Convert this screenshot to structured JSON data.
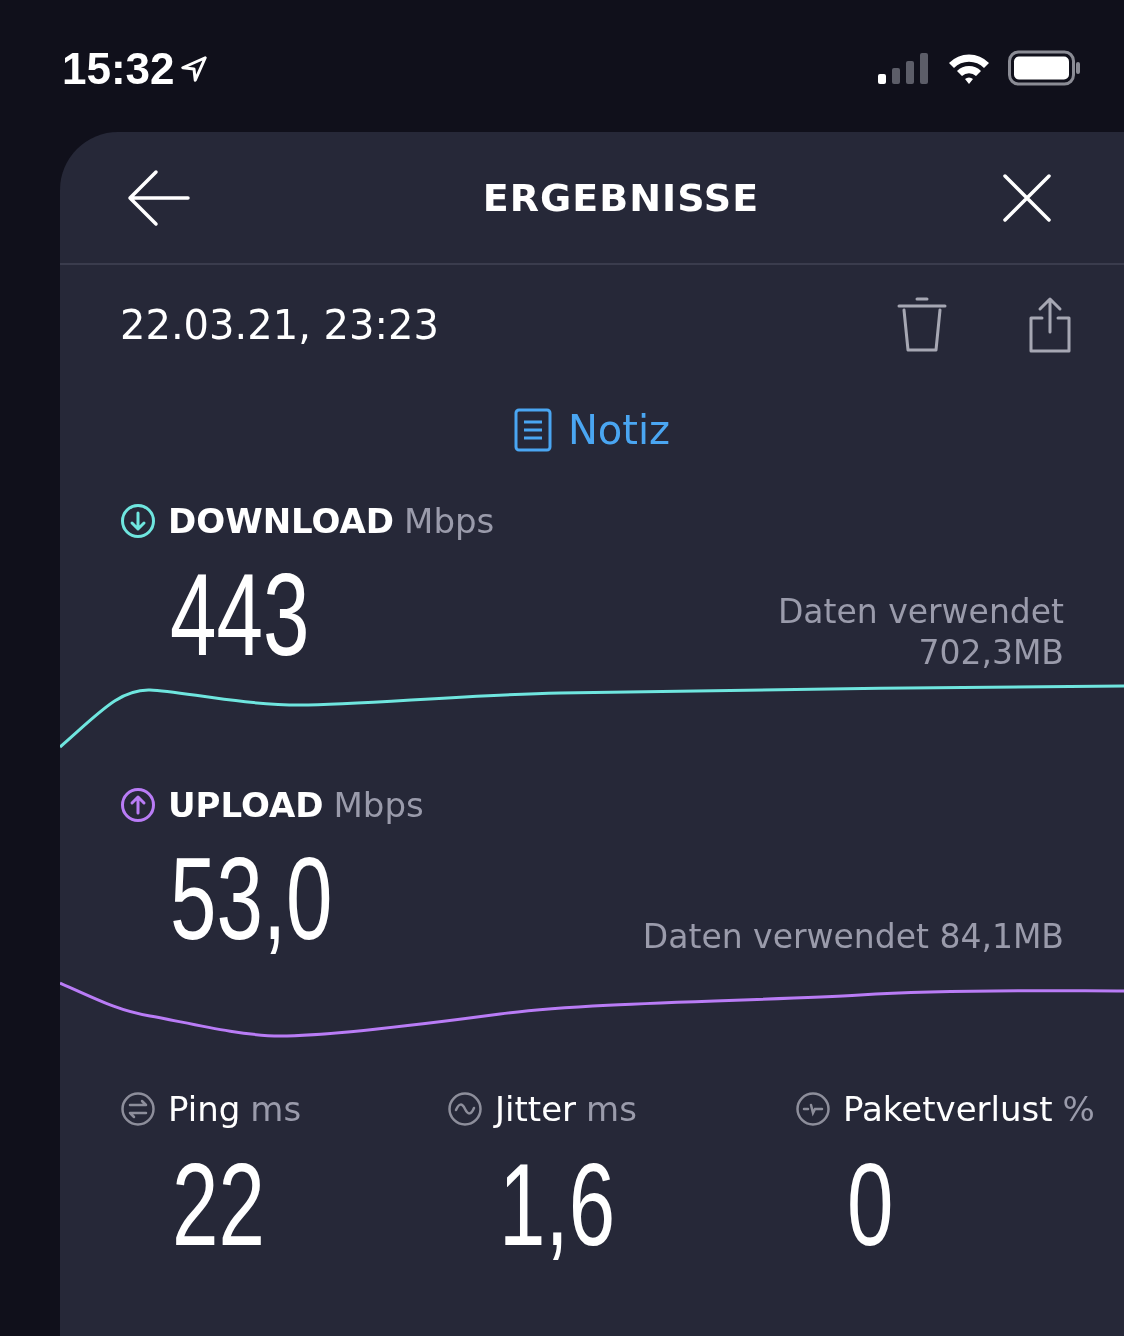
{
  "status_bar": {
    "time": "15:32"
  },
  "header": {
    "title": "ERGEBNISSE"
  },
  "result": {
    "date": "22.03.21, 23:23",
    "note_label": "Notiz"
  },
  "speeds": [
    {
      "kind": "download",
      "label": "DOWNLOAD",
      "unit": "Mbps",
      "value": "443",
      "data_used": [
        "Daten verwendet",
        "702,3MB"
      ]
    },
    {
      "kind": "upload",
      "label": "UPLOAD",
      "unit": "Mbps",
      "value": "53,0",
      "data_used": [
        "Daten verwendet 84,1MB"
      ]
    }
  ],
  "metrics": [
    {
      "kind": "ping",
      "label": "Ping",
      "unit": "ms",
      "value": "22"
    },
    {
      "kind": "jitter",
      "label": "Jitter",
      "unit": "ms",
      "value": "1,6"
    },
    {
      "kind": "loss",
      "label": "Paketverlust",
      "unit": "%",
      "value": "0"
    }
  ]
}
